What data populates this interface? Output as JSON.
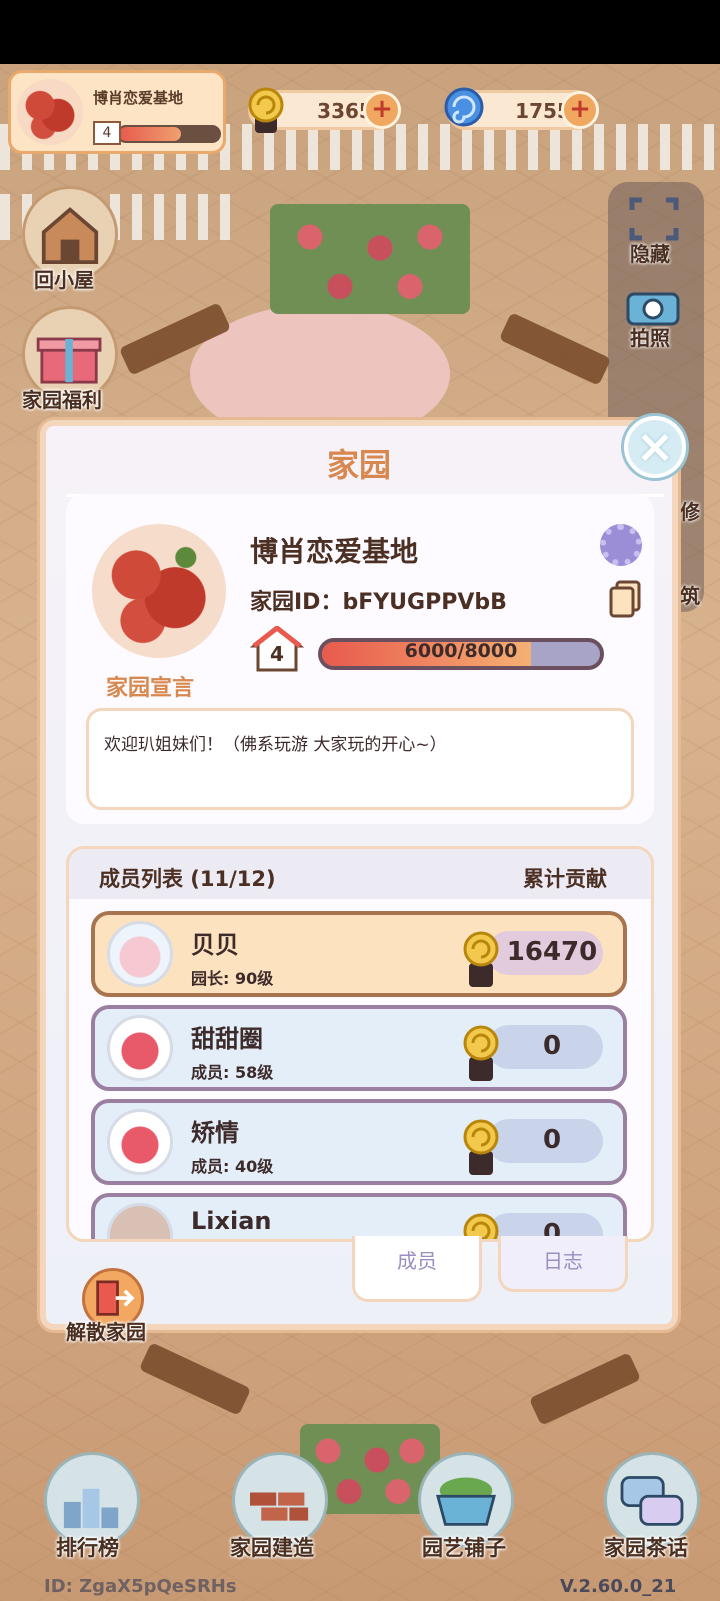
{
  "hud": {
    "garden_name": "博肖恋爱基地",
    "level": "4",
    "level_progress": 0.62,
    "snail_coins": "3365",
    "blue_gems": "1755",
    "plus": "+"
  },
  "left_menu": {
    "home_label": "回小屋",
    "welfare_label": "家园福利"
  },
  "right_menu": {
    "hide_label": "隐藏",
    "photo_label": "拍照",
    "repair_label": "修",
    "build_label": "筑"
  },
  "modal": {
    "title": "家园",
    "close_icon": "×",
    "garden_name": "博肖恋爱基地",
    "garden_id": "家园ID：bFYUGPPVbB",
    "level": "4",
    "exp_text": "6000/8000",
    "exp_fraction": 0.75,
    "declaration_label": "家园宣言",
    "declaration_text": "欢迎玐姐妹们！（佛系玩游 大家玩的开心~）",
    "members_header": "成员列表 (11/12)",
    "contribution_header": "累计贡献",
    "members": [
      {
        "name": "贝贝",
        "role": "园长: 90级",
        "score": "16470"
      },
      {
        "name": "甜甜圈",
        "role": "成员: 58级",
        "score": "0"
      },
      {
        "name": "矫情",
        "role": "成员: 40级",
        "score": "0"
      },
      {
        "name": "Lixian",
        "role": "",
        "score": "0"
      }
    ],
    "tabs": {
      "members": "成员",
      "log": "日志"
    },
    "disband_label": "解散家园"
  },
  "bottom_bar": {
    "rank_label": "排行榜",
    "build_label": "家园建造",
    "shop_label": "园艺铺子",
    "chat_label": "家园茶话"
  },
  "footer": {
    "id_text": "ID: ZgaX5pQeSRHs",
    "version": "V.2.60.0_21"
  },
  "colors": {
    "accent": "#d8884e",
    "panel_border": "#f3d6bc",
    "exp_fill": "#e85a4d"
  }
}
